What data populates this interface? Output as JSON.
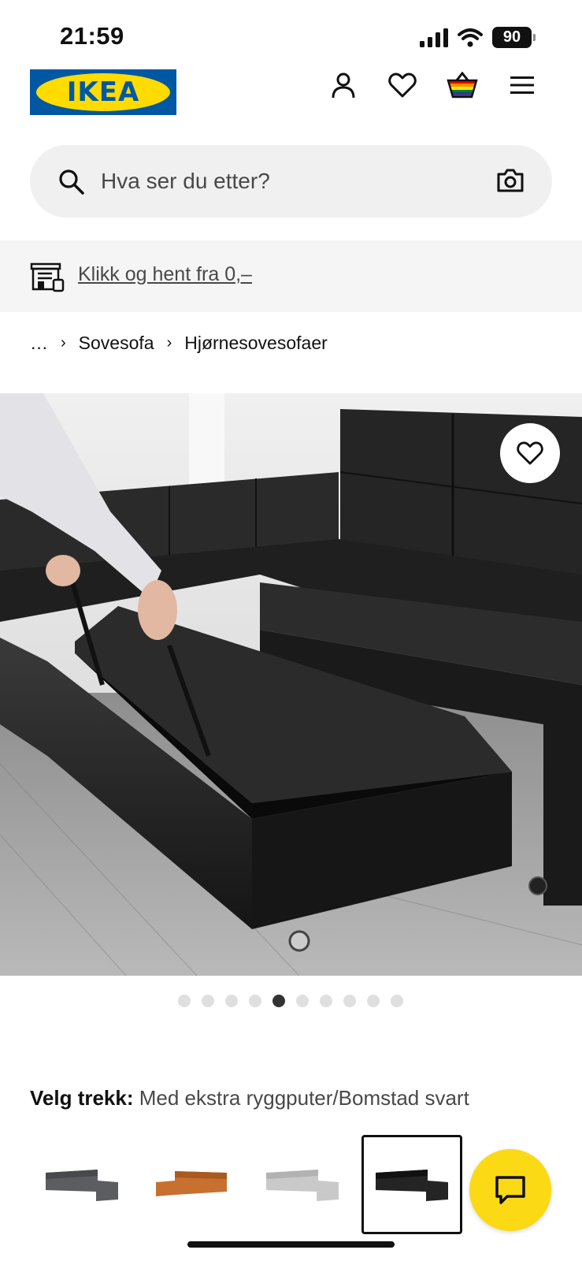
{
  "status_bar": {
    "time": "21:59",
    "battery": "90"
  },
  "header": {
    "logo_text": "IKEA",
    "icons": [
      "person-icon",
      "heart-icon",
      "shopping-bag-icon",
      "menu-icon"
    ]
  },
  "search": {
    "placeholder": "Hva ser du etter?"
  },
  "banner": {
    "link_text": "Klikk og hent fra 0,–"
  },
  "breadcrumb": {
    "ellipsis": "…",
    "items": [
      "Sovesofa",
      "Hjørnesovesofaer"
    ]
  },
  "gallery": {
    "image_count": 10,
    "active_index": 4
  },
  "variant": {
    "label": "Velg trekk:",
    "value": "Med ekstra ryggputer/Bomstad svart",
    "options": [
      {
        "color": "#5b5d61",
        "selected": false
      },
      {
        "color": "#c8702f",
        "selected": false
      },
      {
        "color": "#c9c9c9",
        "selected": false
      },
      {
        "color": "#242424",
        "selected": true
      }
    ]
  },
  "colors": {
    "ikea_blue": "#0058a3",
    "ikea_yellow": "#ffdb00",
    "chat_yellow": "#fbd914"
  }
}
